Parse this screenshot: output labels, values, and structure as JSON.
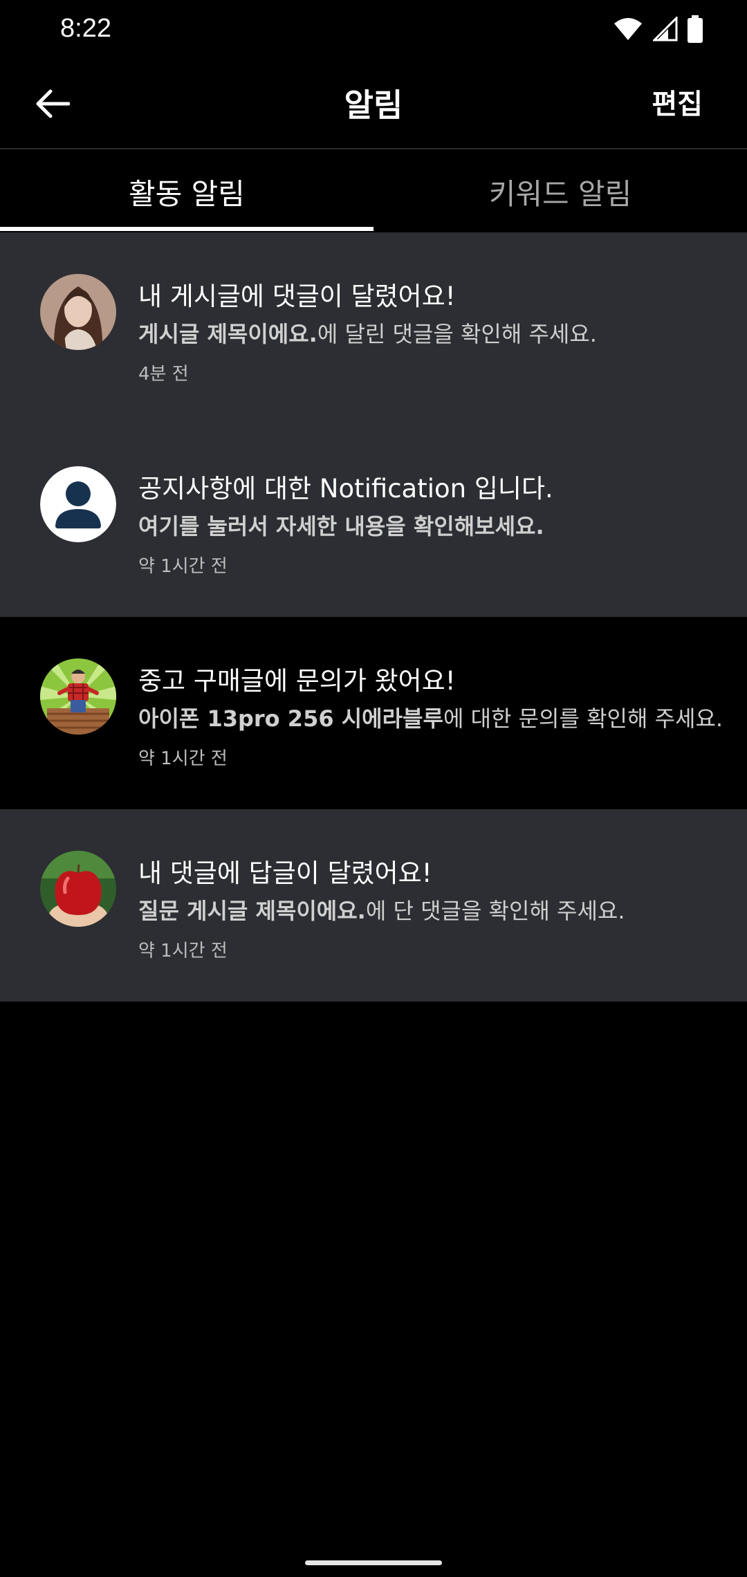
{
  "status_bar": {
    "time": "8:22"
  },
  "app_bar": {
    "title": "알림",
    "edit_label": "편집"
  },
  "tabs": [
    {
      "label": "활동 알림",
      "active": true
    },
    {
      "label": "키워드 알림",
      "active": false
    }
  ],
  "notifications": [
    {
      "title": "내 게시글에 댓글이 달렸어요!",
      "body_bold": "게시글 제목이에요.",
      "body_rest": "에 달린 댓글을 확인해 주세요.",
      "time": "4분 전",
      "avatar": "woman-photo",
      "unread": true
    },
    {
      "title": "공지사항에 대한 Notification 입니다.",
      "body_bold": "여기를 눌러서 자세한 내용을 확인해보세요.",
      "body_rest": "",
      "time": "약 1시간 전",
      "avatar": "default-user-icon",
      "unread": true
    },
    {
      "title": "중고 구매글에 문의가 왔어요!",
      "body_bold": "아이폰 13pro 256 시에라블루",
      "body_rest": "에 대한 문의를 확인해 주세요.",
      "time": "약 1시간 전",
      "avatar": "lumberjack-illustration",
      "unread": false
    },
    {
      "title": "내 댓글에 답글이 달렸어요!",
      "body_bold": "질문 게시글 제목이에요.",
      "body_rest": "에 단 댓글을 확인해 주세요.",
      "time": "약 1시간 전",
      "avatar": "apple-photo",
      "unread": true
    }
  ],
  "colors": {
    "background": "#000000",
    "unread_row": "#2c2e33",
    "tab_indicator": "#ffffff",
    "inactive_tab_text": "#a8a8a8"
  }
}
